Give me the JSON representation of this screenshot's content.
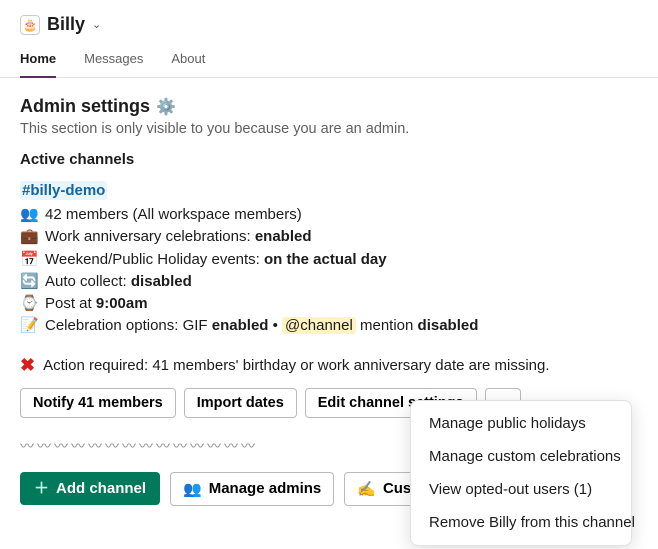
{
  "header": {
    "bot_name": "Billy",
    "bot_icon_glyph": "🎂"
  },
  "tabs": {
    "home": "Home",
    "messages": "Messages",
    "about": "About"
  },
  "settings": {
    "title": "Admin settings",
    "subtitle": "This section is only visible to you because you are an admin."
  },
  "active_channels_label": "Active channels",
  "channel": {
    "name": "#billy-demo",
    "members": {
      "icon": "👥",
      "text": "42 members (All workspace members)"
    },
    "anniversary": {
      "icon": "💼",
      "prefix": "Work anniversary celebrations: ",
      "value": "enabled"
    },
    "weekend": {
      "icon": "📅",
      "prefix": "Weekend/Public Holiday events: ",
      "value": "on the actual day"
    },
    "autocollect": {
      "icon": "🔄",
      "prefix": "Auto collect: ",
      "value": "disabled"
    },
    "postat": {
      "icon": "⌚",
      "prefix": "Post at ",
      "value": "9:00am"
    },
    "celebration": {
      "icon": "📝",
      "prefix": "Celebration options: GIF ",
      "gif_value": "enabled",
      "bullet": " • ",
      "mention": "@channel",
      "mention_suffix": " mention ",
      "mention_value": "disabled"
    },
    "action_required": "Action required: 41 members' birthday or work anniversary date are missing."
  },
  "buttons": {
    "notify": "Notify 41 members",
    "import": "Import dates",
    "edit": "Edit channel settings",
    "more": "⋯",
    "add_channel": "Add channel",
    "manage_admins": "Manage admins",
    "customize": "Customize mess"
  },
  "divider": "〰〰〰〰〰〰〰〰〰〰〰〰〰〰",
  "popup": {
    "holidays": "Manage public holidays",
    "custom": "Manage custom celebrations",
    "opted": "View opted-out users (1)",
    "remove": "Remove Billy from this channel"
  }
}
